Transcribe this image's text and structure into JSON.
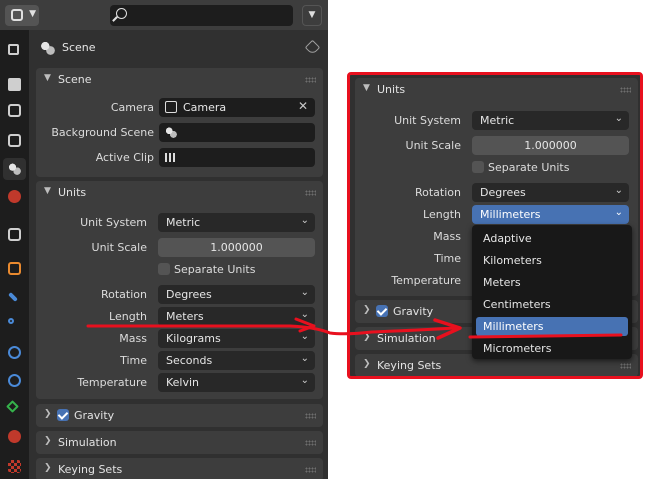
{
  "colors": {
    "accent_blue": "#4772b3",
    "annotation_red": "#e8101e",
    "panel_bg": "#3d3d3d",
    "area_bg": "#303030",
    "field_bg": "#1d1d1d"
  },
  "toolbar": {
    "editor_icon": "properties-editor-icon",
    "search_icon": "search-icon",
    "search_placeholder": ""
  },
  "tabs": [
    "tool-icon",
    "render-icon",
    "output-icon",
    "view-layer-icon",
    "scene-icon",
    "world-icon",
    "collection-icon",
    "object-icon",
    "modifier-icon",
    "particles-icon",
    "physics-icon",
    "constraints-icon",
    "data-icon",
    "material-icon",
    "texture-icon"
  ],
  "scene_header": {
    "title": "Scene"
  },
  "scene_panel": {
    "title": "Scene",
    "camera_label": "Camera",
    "camera_value": "Camera",
    "bg_scene_label": "Background Scene",
    "active_clip_label": "Active Clip"
  },
  "units_panel": {
    "title": "Units",
    "unit_system_label": "Unit System",
    "unit_system_value": "Metric",
    "unit_scale_label": "Unit Scale",
    "unit_scale_value": "1.000000",
    "separate_units_label": "Separate Units",
    "rotation_label": "Rotation",
    "rotation_value": "Degrees",
    "length_label": "Length",
    "length_value": "Meters",
    "mass_label": "Mass",
    "mass_value": "Kilograms",
    "time_label": "Time",
    "time_value": "Seconds",
    "temperature_label": "Temperature",
    "temperature_value": "Kelvin"
  },
  "collapsed_panels": {
    "gravity": "Gravity",
    "simulation": "Simulation",
    "keying_sets": "Keying Sets"
  },
  "callout": {
    "units_title": "Units",
    "unit_system_label": "Unit System",
    "unit_system_value": "Metric",
    "unit_scale_label": "Unit Scale",
    "unit_scale_value": "1.000000",
    "separate_units_label": "Separate Units",
    "rotation_label": "Rotation",
    "rotation_value": "Degrees",
    "length_label": "Length",
    "length_value": "Millimeters",
    "mass_label": "Mass",
    "time_label": "Time",
    "temperature_label": "Temperature",
    "gravity": "Gravity",
    "simulation": "Simulation",
    "keying_sets": "Keying Sets",
    "dropdown_options": [
      "Adaptive",
      "Kilometers",
      "Meters",
      "Centimeters",
      "Millimeters",
      "Micrometers"
    ],
    "dropdown_selected": "Millimeters"
  }
}
